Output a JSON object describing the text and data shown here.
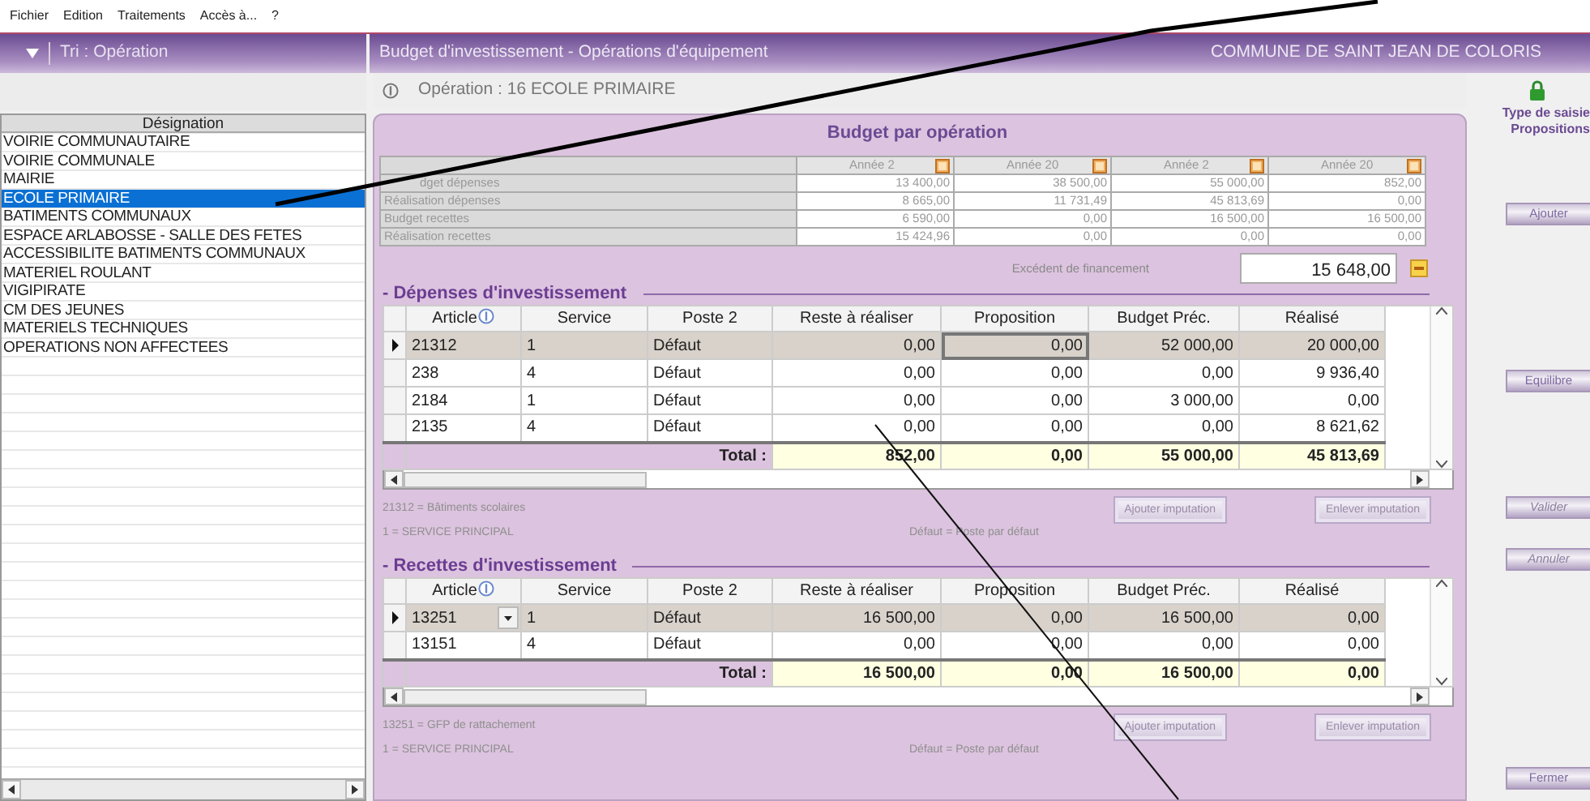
{
  "menu": [
    "Fichier",
    "Edition",
    "Traitements",
    "Accès à...",
    "?"
  ],
  "left_panel": {
    "title": "Tri : Opération",
    "column": "Désignation",
    "items": [
      {
        "label": "VOIRIE COMMUNAUTAIRE",
        "selected": false
      },
      {
        "label": "VOIRIE COMMUNALE",
        "selected": false
      },
      {
        "label": "MAIRIE",
        "selected": false
      },
      {
        "label": "ECOLE PRIMAIRE",
        "selected": true
      },
      {
        "label": "BATIMENTS COMMUNAUX",
        "selected": false
      },
      {
        "label": "ESPACE ARLABOSSE - SALLE DES FETES",
        "selected": false
      },
      {
        "label": "ACCESSIBILITE BATIMENTS COMMUNAUX",
        "selected": false
      },
      {
        "label": "MATERIEL ROULANT",
        "selected": false
      },
      {
        "label": "VIGIPIRATE",
        "selected": false
      },
      {
        "label": "CM DES JEUNES",
        "selected": false
      },
      {
        "label": "MATERIELS TECHNIQUES",
        "selected": false
      },
      {
        "label": "OPERATIONS NON AFFECTEES",
        "selected": false
      }
    ]
  },
  "header": {
    "title": "Budget d'investissement - Opérations d'équipement",
    "commune": "COMMUNE DE SAINT JEAN DE COLORIS"
  },
  "operation": "Opération : 16 ECOLE PRIMAIRE",
  "summary": {
    "title": "Budget par opération",
    "years": [
      "Année 2",
      "Année 20",
      "Année 2",
      "Année 20"
    ],
    "rows": [
      {
        "label": "dget dépenses",
        "values": [
          "13 400,00",
          "38 500,00",
          "55 000,00",
          "852,00"
        ]
      },
      {
        "label": "Réalisation dépenses",
        "values": [
          "8 665,00",
          "11 731,49",
          "45 813,69",
          "0,00"
        ]
      },
      {
        "label": "Budget recettes",
        "values": [
          "6 590,00",
          "0,00",
          "16 500,00",
          "16 500,00"
        ]
      },
      {
        "label": "Réalisation recettes",
        "values": [
          "15 424,96",
          "0,00",
          "0,00",
          "0,00"
        ]
      }
    ]
  },
  "excedent": {
    "label": "Excédent de financement",
    "value": "15 648,00"
  },
  "sections": [
    {
      "title": "- Dépenses d'investissement",
      "columns": [
        "Article",
        "Service",
        "Poste 2",
        "Reste à réaliser",
        "Proposition",
        "Budget Préc.",
        "Réalisé"
      ],
      "rows": [
        {
          "selected": true,
          "dropdown": false,
          "cells": [
            "21312",
            "1",
            "Défaut",
            "0,00",
            "0,00",
            "52 000,00",
            "20 000,00"
          ]
        },
        {
          "selected": false,
          "dropdown": false,
          "cells": [
            "238",
            "4",
            "Défaut",
            "0,00",
            "0,00",
            "0,00",
            "9 936,40"
          ]
        },
        {
          "selected": false,
          "dropdown": false,
          "cells": [
            "2184",
            "1",
            "Défaut",
            "0,00",
            "0,00",
            "3 000,00",
            "0,00"
          ]
        },
        {
          "selected": false,
          "dropdown": false,
          "cells": [
            "2135",
            "4",
            "Défaut",
            "0,00",
            "0,00",
            "0,00",
            "8 621,62"
          ]
        }
      ],
      "total": {
        "label": "Total :",
        "values": [
          "852,00",
          "0,00",
          "55 000,00",
          "45 813,69"
        ]
      },
      "note": "21312 = Bâtiments scolaires",
      "buttons": [
        "Ajouter imputation",
        "Enlever imputation"
      ],
      "legend": [
        "1 = SERVICE PRINCIPAL",
        "Défaut = Poste par défaut"
      ]
    },
    {
      "title": "- Recettes d'investissement",
      "columns": [
        "Article",
        "Service",
        "Poste 2",
        "Reste à réaliser",
        "Proposition",
        "Budget Préc.",
        "Réalisé"
      ],
      "rows": [
        {
          "selected": true,
          "dropdown": true,
          "cells": [
            "13251",
            "1",
            "Défaut",
            "16 500,00",
            "0,00",
            "16 500,00",
            "0,00"
          ]
        },
        {
          "selected": false,
          "dropdown": false,
          "cells": [
            "13151",
            "4",
            "Défaut",
            "0,00",
            "0,00",
            "0,00",
            "0,00"
          ]
        }
      ],
      "total": {
        "label": "Total :",
        "values": [
          "16 500,00",
          "0,00",
          "16 500,00",
          "0,00"
        ]
      },
      "note": "13251 = GFP de rattachement",
      "buttons": [
        "Ajouter imputation",
        "Enlever imputation"
      ],
      "legend": [
        "1 = SERVICE PRINCIPAL",
        "Défaut = Poste par défaut"
      ]
    }
  ],
  "side": {
    "type_label": "Type de saisie",
    "type_value": "Propositions",
    "buttons": [
      {
        "label": "Ajouter",
        "disabled": false
      },
      {
        "label": "Equilibre",
        "disabled": false
      },
      {
        "label": "Valider",
        "disabled": true
      },
      {
        "label": "Annuler",
        "disabled": true
      },
      {
        "label": "Fermer",
        "disabled": false
      }
    ]
  }
}
